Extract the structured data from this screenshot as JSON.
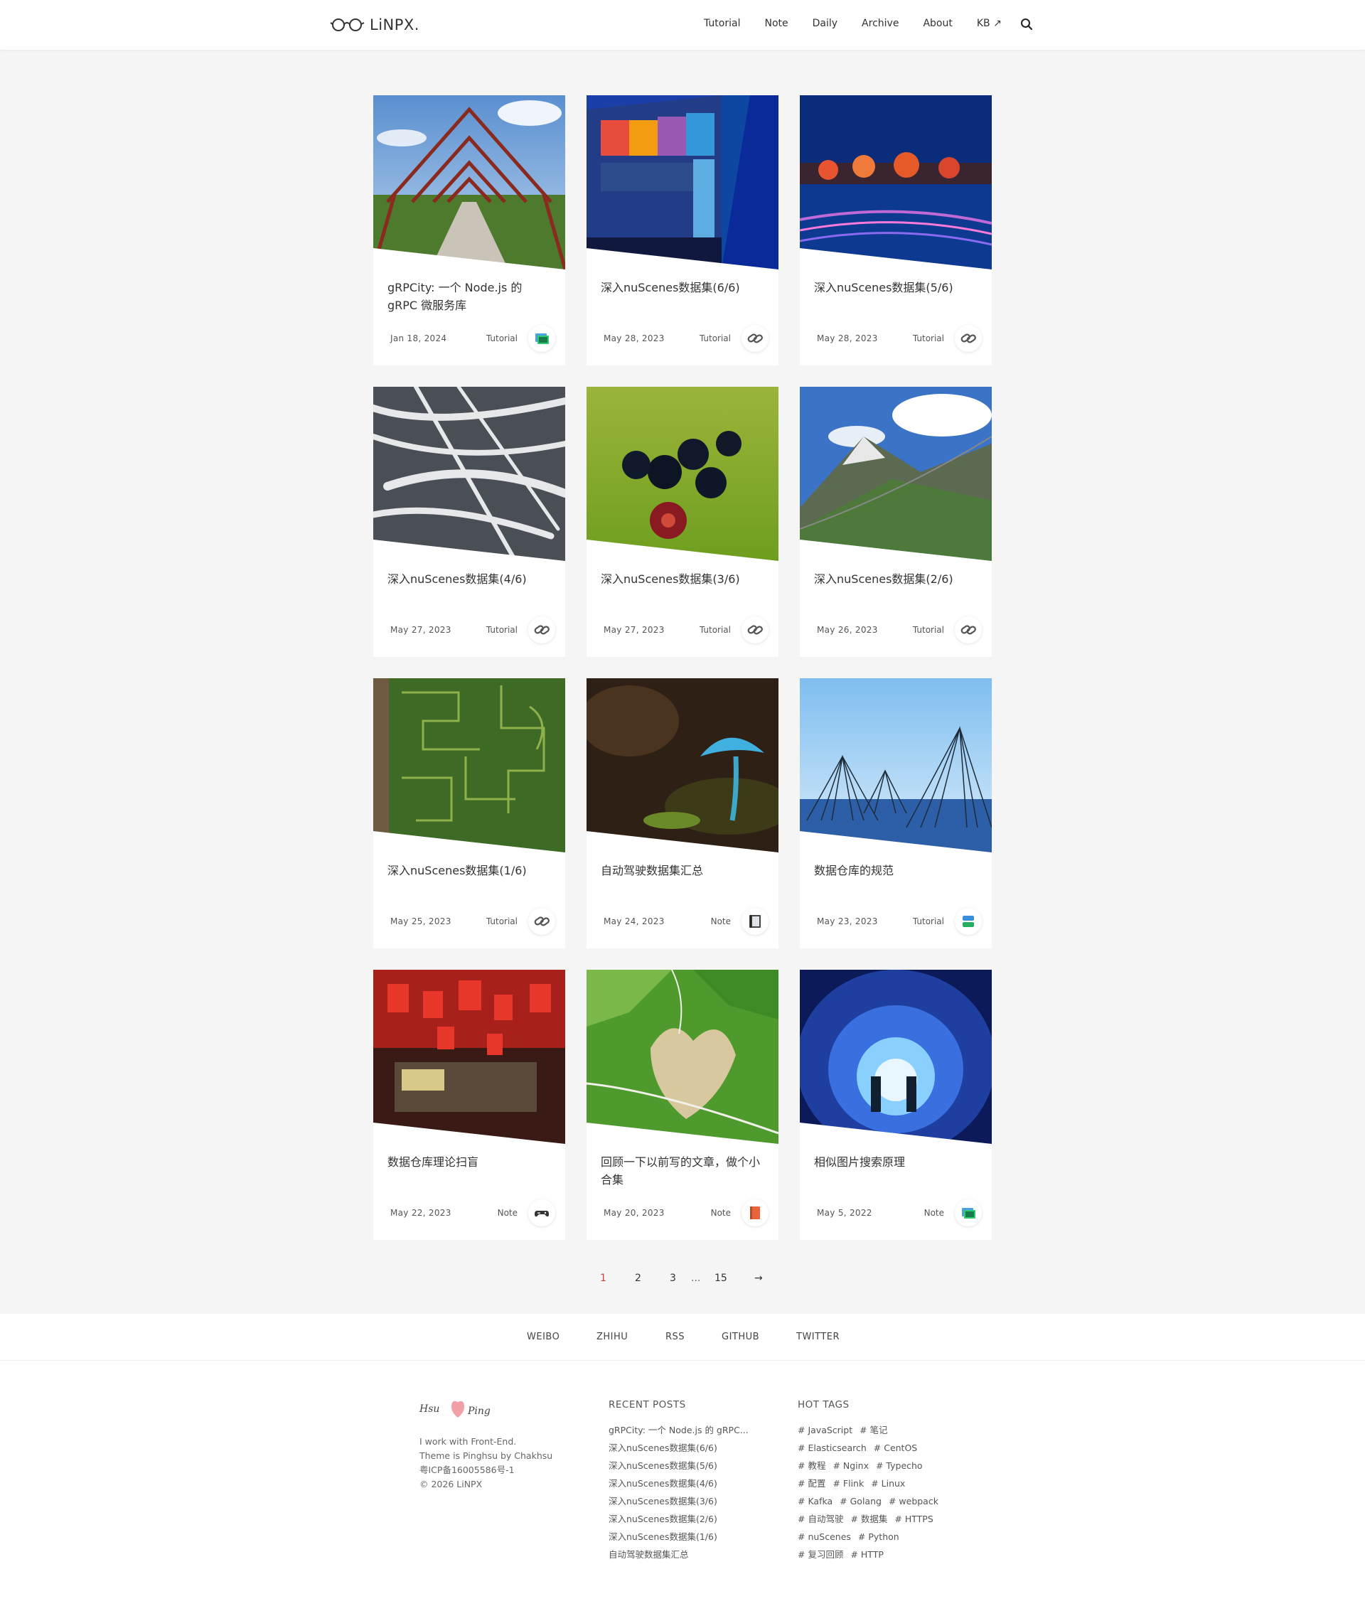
{
  "site": {
    "logo_text": "LiNPX."
  },
  "nav": {
    "items": [
      {
        "label": "Tutorial"
      },
      {
        "label": "Note"
      },
      {
        "label": "Daily"
      },
      {
        "label": "Archive"
      },
      {
        "label": "About"
      },
      {
        "label": "KB ↗"
      }
    ],
    "search_icon": "search-icon"
  },
  "posts": [
    {
      "title": "gRPCity: 一个 Node.js 的 gRPC 微服务库",
      "date": "Jan 18, 2024",
      "category": "Tutorial",
      "icon": "image-icon",
      "image": "steel-pedestrian-bridge"
    },
    {
      "title": "深入nuScenes数据集(6/6)",
      "date": "May 28, 2023",
      "category": "Tutorial",
      "icon": "link-icon",
      "image": "glass-building"
    },
    {
      "title": "深入nuScenes数据集(5/6)",
      "date": "May 28, 2023",
      "category": "Tutorial",
      "icon": "link-icon",
      "image": "night-lake-lights"
    },
    {
      "title": "深入nuScenes数据集(4/6)",
      "date": "May 27, 2023",
      "category": "Tutorial",
      "icon": "link-icon",
      "image": "cloud-contrails"
    },
    {
      "title": "深入nuScenes数据集(3/6)",
      "date": "May 27, 2023",
      "category": "Tutorial",
      "icon": "link-icon",
      "image": "lawn-bowls"
    },
    {
      "title": "深入nuScenes数据集(2/6)",
      "date": "May 26, 2023",
      "category": "Tutorial",
      "icon": "link-icon",
      "image": "mountain-suspension-bridge"
    },
    {
      "title": "深入nuScenes数据集(1/6)",
      "date": "May 25, 2023",
      "category": "Tutorial",
      "icon": "link-icon",
      "image": "corn-maze"
    },
    {
      "title": "自动驾驶数据集汇总",
      "date": "May 24, 2023",
      "category": "Note",
      "icon": "notebook-icon",
      "image": "blue-mushroom"
    },
    {
      "title": "数据仓库的规范",
      "date": "May 23, 2023",
      "category": "Tutorial",
      "icon": "database-icon",
      "image": "teepee-frames-snow"
    },
    {
      "title": "数据仓库理论扫盲",
      "date": "May 22, 2023",
      "category": "Note",
      "icon": "gamepad-icon",
      "image": "red-lanterns-street"
    },
    {
      "title": "回顾一下以前写的文章，做个小合集",
      "date": "May 20, 2023",
      "category": "Note",
      "icon": "book-icon",
      "image": "heart-shaped-field"
    },
    {
      "title": "相似图片搜索原理",
      "date": "May 5, 2022",
      "category": "Note",
      "icon": "image-icon",
      "image": "light-tunnel"
    }
  ],
  "pagination": {
    "pages": [
      "1",
      "2",
      "3"
    ],
    "ellipsis": "...",
    "last": "15",
    "next": "→",
    "current": "1"
  },
  "social": [
    "WEIBO",
    "ZHIHU",
    "RSS",
    "GITHUB",
    "TWITTER"
  ],
  "footer": {
    "signature": "Hsu Ping",
    "about": [
      "I work with Front-End.",
      "Theme is Pinghsu by Chakhsu",
      "粤ICP备16005586号-1",
      "© 2026 LiNPX"
    ],
    "recent_heading": "RECENT POSTS",
    "recent_posts": [
      "gRPCity: 一个 Node.js 的 gRPC...",
      "深入nuScenes数据集(6/6)",
      "深入nuScenes数据集(5/6)",
      "深入nuScenes数据集(4/6)",
      "深入nuScenes数据集(3/6)",
      "深入nuScenes数据集(2/6)",
      "深入nuScenes数据集(1/6)",
      "自动驾驶数据集汇总"
    ],
    "tags_heading": "HOT TAGS",
    "tag_rows": [
      [
        "# JavaScript",
        "# 笔记"
      ],
      [
        "# Elasticsearch",
        "# CentOS"
      ],
      [
        "# 教程",
        "# Nginx",
        "# Typecho"
      ],
      [
        "# 配置",
        "# Flink",
        "# Linux"
      ],
      [
        "# Kafka",
        "# Golang",
        "# webpack"
      ],
      [
        "# 自动驾驶",
        "# 数据集",
        "# HTTPS"
      ],
      [
        "# nuScenes",
        "# Python"
      ],
      [
        "# 复习回顾",
        "# HTTP"
      ]
    ]
  },
  "colors": {
    "accent": "#d0443f",
    "page_bg": "#f5f5f5"
  }
}
